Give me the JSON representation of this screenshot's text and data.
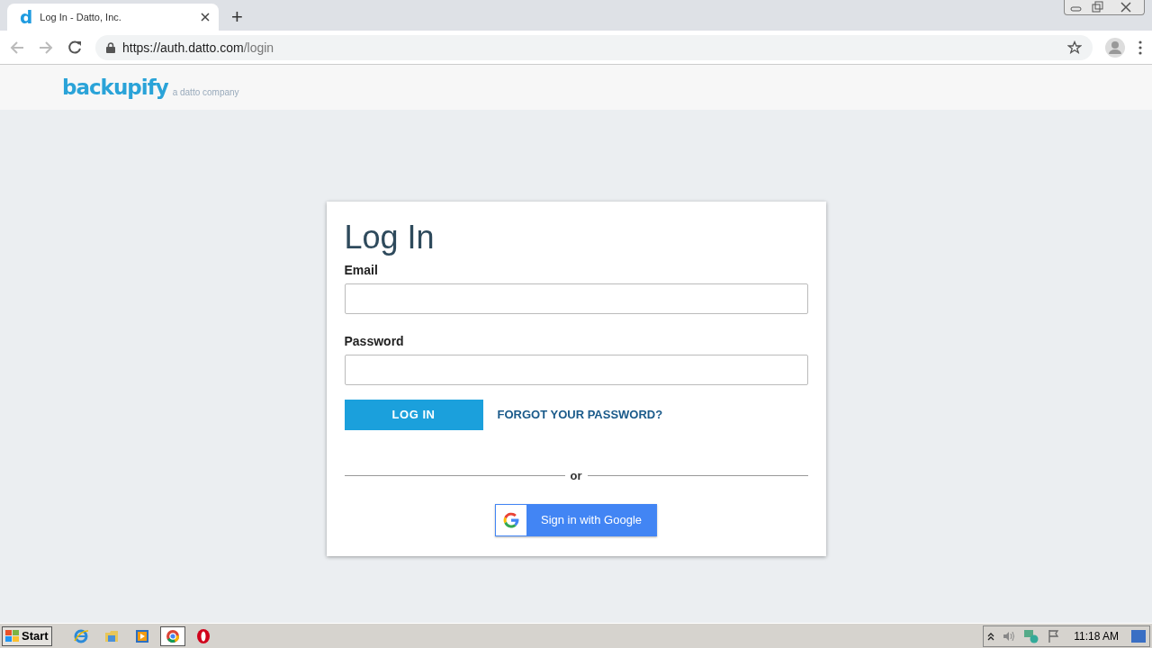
{
  "browser": {
    "tab": {
      "title": "Log In - Datto, Inc.",
      "favicon": "d",
      "selected": true
    },
    "new_tab": "+",
    "url_base": "https://auth.datto.com",
    "url_path": "/login"
  },
  "header": {
    "logo": "backupify",
    "tagline": "a datto company"
  },
  "login": {
    "title": "Log In",
    "fields": [
      {
        "label": "Email"
      },
      {
        "label": "Password"
      }
    ],
    "login_button": "LOG IN",
    "forgot_link": "FORGOT YOUR PASSWORD?",
    "separator": "or",
    "google_button": "Sign in with Google"
  },
  "taskbar": {
    "start": "Start",
    "apps": [
      {
        "kind": "ie",
        "selected": false
      },
      {
        "kind": "folder",
        "selected": false
      },
      {
        "kind": "media",
        "selected": false
      },
      {
        "kind": "chrome",
        "selected": true
      },
      {
        "kind": "opera",
        "selected": false
      }
    ],
    "clock": "11:18 AM"
  }
}
